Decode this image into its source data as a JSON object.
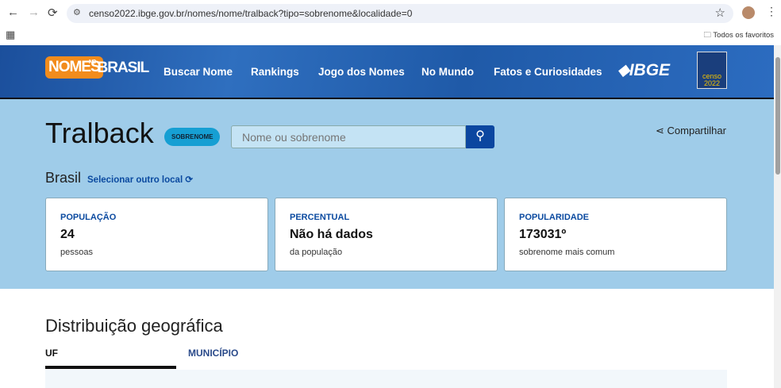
{
  "browser": {
    "url": "censo2022.ibge.gov.br/nomes/nome/tralback?tipo=sobrenome&localidade=0",
    "bookmarks_label": "Todos os favoritos"
  },
  "header": {
    "logo_nomes": "NOMES",
    "logo_no": "NO",
    "logo_brasil": "BRASIL",
    "nav": [
      "Buscar Nome",
      "Rankings",
      "Jogo dos Nomes",
      "No Mundo",
      "Fatos e Curiosidades"
    ],
    "ibge": "IBGE",
    "censo": "censo 2022"
  },
  "hero": {
    "name": "Tralback",
    "badge": "SOBRENOME",
    "search_placeholder": "Nome ou sobrenome",
    "share": "Compartilhar",
    "place": "Brasil",
    "change_place": "Selecionar outro local"
  },
  "cards": [
    {
      "label": "POPULAÇÃO",
      "value": "24",
      "sub": "pessoas"
    },
    {
      "label": "PERCENTUAL",
      "value": "Não há dados",
      "sub": "da população"
    },
    {
      "label": "POPULARIDADE",
      "value": "173031º",
      "sub": "sobrenome mais comum"
    }
  ],
  "distribution": {
    "title": "Distribuição geográfica",
    "tabs": [
      "UF",
      "MUNICÍPIO"
    ]
  },
  "colors": {
    "accent": "#0b46a0",
    "hero_bg": "#9fcce9",
    "logo_orange": "#f28c1c"
  }
}
